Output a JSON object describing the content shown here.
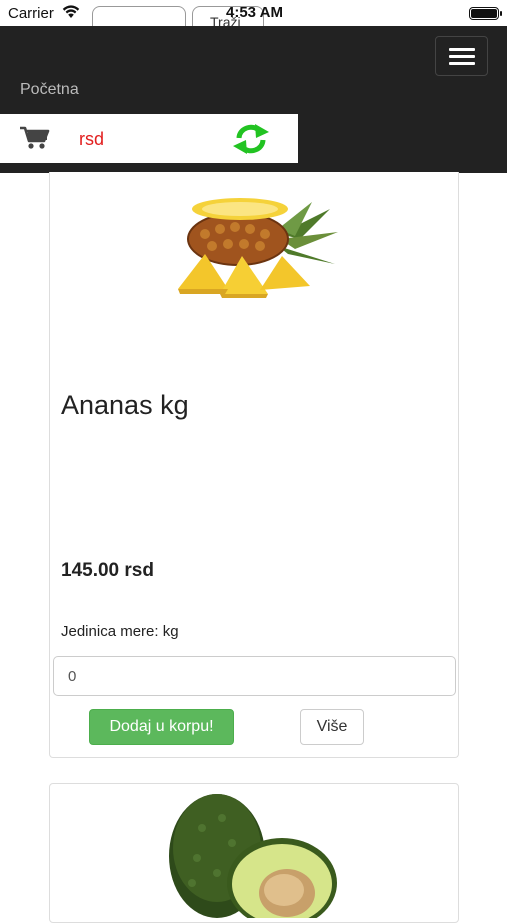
{
  "status_bar": {
    "carrier": "Carrier",
    "time": "4:53 AM",
    "browser_tab": "Traži"
  },
  "navbar": {
    "brand": "Početna",
    "menu_icon": "hamburger-menu-icon",
    "cart": {
      "icon": "shopping-cart-icon",
      "currency": "rsd",
      "refresh_icon": "refresh-icon"
    }
  },
  "products": [
    {
      "image_icon": "pineapple-image",
      "title": "Ananas kg",
      "price": "145.00 rsd",
      "unit": "Jedinica mere: kg",
      "quantity": "0",
      "add_button": "Dodaj u korpu!",
      "more_button": "Više"
    },
    {
      "image_icon": "avocado-image"
    }
  ],
  "colors": {
    "navbar_bg": "#222222",
    "currency_red": "#e21e1e",
    "add_button_green": "#5cb85c",
    "refresh_green": "#22c322"
  }
}
